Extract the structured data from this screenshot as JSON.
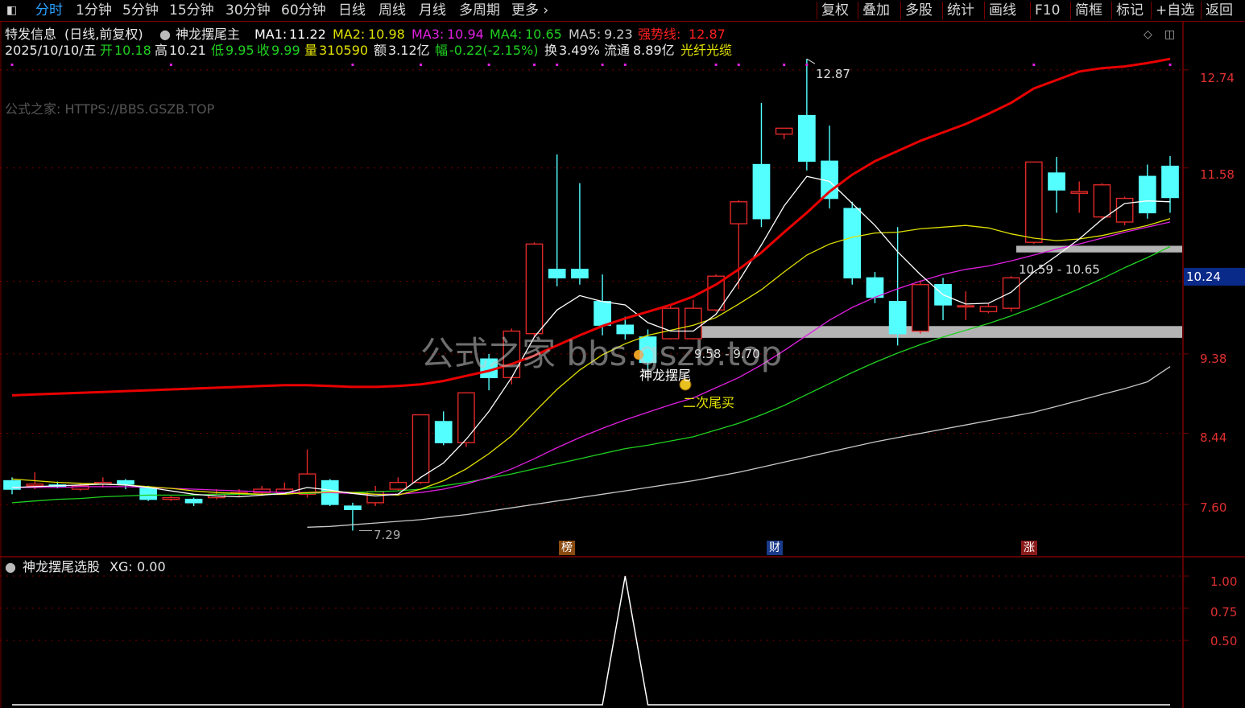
{
  "toolbar": {
    "period_tabs": [
      "分时",
      "1分钟",
      "5分钟",
      "15分钟",
      "30分钟",
      "60分钟",
      "日线",
      "周线",
      "月线",
      "多周期",
      "更多"
    ],
    "active_tab": "分时",
    "right_buttons": [
      "复权",
      "叠加",
      "多股",
      "统计",
      "画线",
      "F10",
      "简框",
      "标记",
      "+自选",
      "返回"
    ]
  },
  "header": {
    "stock_name": "特发信息",
    "mode": "(日线,前复权)",
    "indicator_name": "神龙摆尾主",
    "ma1_label": "MA1:",
    "ma1_value": "11.22",
    "ma2_label": "MA2:",
    "ma2_value": "10.98",
    "ma3_label": "MA3:",
    "ma3_value": "10.94",
    "ma4_label": "MA4:",
    "ma4_value": "10.65",
    "ma5_label": "MA5:",
    "ma5_value": "9.23",
    "strong_label": "强势线:",
    "strong_value": "12.87"
  },
  "quote": {
    "date": "2025/10/10/五",
    "open_label": "开",
    "open": "10.18",
    "high_label": "高",
    "high": "10.21",
    "low_label": "低",
    "low": "9.95",
    "close_label": "收",
    "close": "9.99",
    "vol_label": "量",
    "vol": "310590",
    "amt_label": "额",
    "amt": "3.12亿",
    "chg_label": "幅",
    "chg": "-0.22(-2.15%)",
    "turn_label": "换",
    "turn": "3.49%",
    "float_label": "流通",
    "float": "8.89亿",
    "sector": "光纤光缆"
  },
  "watermark_text": "公式之家: HTTPS://BBS.GSZB.TOP",
  "center_watermark": "公式之家 bbs.gszb.top",
  "annotations": {
    "peak": "12.87",
    "trough": "7.29",
    "zone1": "9.58 - 9.70",
    "zone2": "10.59 - 10.65",
    "signal1": "神龙摆尾",
    "signal2": "二次尾买",
    "mark_bang": "榜",
    "mark_cai": "财",
    "mark_zhang": "涨"
  },
  "price_axis": [
    "12.74",
    "11.58",
    "10.24",
    "9.38",
    "8.44",
    "7.60"
  ],
  "current_price_tag": "10.24",
  "sub_panel": {
    "title": "神龙摆尾选股",
    "xg_label": "XG:",
    "xg_value": "0.00",
    "axis": [
      "1.00",
      "0.75",
      "0.50"
    ]
  },
  "colors": {
    "up": "#e02828",
    "down": "#54ffff",
    "ma1": "#ffffff",
    "ma2": "#e0e000",
    "ma3": "#e020e0",
    "ma4": "#20d020",
    "ma5": "#c8c8c8",
    "strong": "#e80000",
    "grid": "#7a0000",
    "active_tab": "#2aa0ff"
  },
  "chart_data": {
    "type": "candlestick",
    "candles": [
      [
        7.88,
        7.78,
        7.92,
        7.72
      ],
      [
        7.82,
        7.84,
        7.98,
        7.78
      ],
      [
        7.83,
        7.82,
        7.87,
        7.79
      ],
      [
        7.78,
        7.82,
        7.85,
        7.76
      ],
      [
        7.84,
        7.86,
        7.92,
        7.8
      ],
      [
        7.88,
        7.84,
        7.9,
        7.78
      ],
      [
        7.8,
        7.66,
        7.82,
        7.64
      ],
      [
        7.66,
        7.68,
        7.7,
        7.64
      ],
      [
        7.66,
        7.62,
        7.68,
        7.58
      ],
      [
        7.68,
        7.72,
        7.78,
        7.66
      ],
      [
        7.72,
        7.74,
        7.78,
        7.7
      ],
      [
        7.74,
        7.78,
        7.82,
        7.7
      ],
      [
        7.74,
        7.78,
        7.86,
        7.72
      ],
      [
        7.72,
        7.96,
        8.25,
        7.68
      ],
      [
        7.88,
        7.6,
        7.9,
        7.58
      ],
      [
        7.58,
        7.54,
        7.62,
        7.29
      ],
      [
        7.62,
        7.75,
        7.82,
        7.58
      ],
      [
        7.78,
        7.86,
        7.92,
        7.76
      ],
      [
        7.86,
        8.66,
        8.66,
        7.84
      ],
      [
        8.58,
        8.33,
        8.7,
        8.3
      ],
      [
        8.33,
        8.92,
        8.92,
        8.28
      ],
      [
        9.32,
        9.1,
        9.38,
        8.95
      ],
      [
        9.1,
        9.65,
        9.68,
        9.02
      ],
      [
        9.62,
        10.68,
        10.7,
        9.58
      ],
      [
        10.38,
        10.28,
        11.74,
        10.18
      ],
      [
        10.38,
        10.28,
        11.4,
        10.2
      ],
      [
        10.0,
        9.72,
        10.32,
        9.6
      ],
      [
        9.72,
        9.62,
        9.82,
        9.55
      ],
      [
        9.58,
        9.28,
        9.67,
        9.2
      ],
      [
        9.56,
        9.92,
        9.95,
        9.55
      ],
      [
        9.56,
        9.92,
        10.02,
        9.55
      ],
      [
        9.9,
        10.3,
        10.32,
        9.88
      ],
      [
        10.92,
        11.18,
        11.2,
        10.15
      ],
      [
        11.62,
        10.98,
        12.35,
        10.88
      ],
      [
        11.98,
        12.05,
        12.05,
        11.92
      ],
      [
        12.2,
        11.66,
        12.87,
        11.55
      ],
      [
        11.66,
        11.22,
        12.08,
        11.1
      ],
      [
        11.1,
        10.28,
        11.18,
        10.2
      ],
      [
        10.28,
        10.05,
        10.35,
        9.98
      ],
      [
        10.0,
        9.62,
        10.88,
        9.48
      ],
      [
        9.65,
        10.2,
        10.25,
        9.62
      ],
      [
        10.2,
        9.96,
        10.28,
        9.78
      ],
      [
        9.95,
        9.95,
        10.12,
        9.78
      ],
      [
        9.88,
        9.94,
        9.98,
        9.86
      ],
      [
        9.92,
        10.28,
        10.3,
        9.88
      ],
      [
        10.7,
        11.65,
        11.65,
        10.68
      ],
      [
        11.52,
        11.32,
        11.71,
        11.05
      ],
      [
        11.28,
        11.3,
        11.42,
        11.05
      ],
      [
        11.0,
        11.38,
        11.4,
        10.98
      ],
      [
        10.94,
        11.22,
        11.24,
        10.9
      ],
      [
        11.48,
        11.05,
        11.62,
        10.98
      ],
      [
        11.6,
        11.23,
        11.72,
        11.05
      ]
    ],
    "ma1": [
      7.8,
      7.81,
      7.82,
      7.83,
      7.84,
      7.83,
      7.8,
      7.76,
      7.72,
      7.7,
      7.69,
      7.71,
      7.73,
      7.8,
      7.77,
      7.73,
      7.7,
      7.72,
      7.92,
      8.09,
      8.37,
      8.7,
      9.1,
      9.58,
      9.9,
      10.07,
      10.0,
      9.96,
      9.75,
      9.65,
      9.65,
      9.85,
      10.24,
      10.67,
      11.13,
      11.48,
      11.42,
      11.16,
      10.9,
      10.59,
      10.32,
      10.08,
      9.97,
      9.98,
      10.11,
      10.35,
      10.54,
      10.74,
      10.97,
      11.16,
      11.19,
      11.18
    ],
    "ma2": [
      7.9,
      7.88,
      7.86,
      7.85,
      7.84,
      7.83,
      7.81,
      7.79,
      7.76,
      7.74,
      7.73,
      7.72,
      7.72,
      7.74,
      7.75,
      7.74,
      7.72,
      7.71,
      7.78,
      7.88,
      8.02,
      8.2,
      8.41,
      8.69,
      8.96,
      9.19,
      9.37,
      9.5,
      9.6,
      9.66,
      9.72,
      9.81,
      9.97,
      10.14,
      10.35,
      10.55,
      10.68,
      10.76,
      10.81,
      10.82,
      10.86,
      10.88,
      10.9,
      10.87,
      10.8,
      10.75,
      10.72,
      10.74,
      10.78,
      10.84,
      10.9,
      10.98
    ],
    "ma3": [
      7.8,
      7.8,
      7.8,
      7.81,
      7.81,
      7.81,
      7.8,
      7.79,
      7.78,
      7.77,
      7.76,
      7.75,
      7.74,
      7.74,
      7.74,
      7.73,
      7.72,
      7.72,
      7.74,
      7.78,
      7.84,
      7.92,
      8.02,
      8.14,
      8.27,
      8.39,
      8.5,
      8.6,
      8.69,
      8.78,
      8.86,
      8.98,
      9.1,
      9.25,
      9.42,
      9.6,
      9.78,
      9.93,
      10.05,
      10.15,
      10.24,
      10.32,
      10.38,
      10.42,
      10.48,
      10.55,
      10.62,
      10.68,
      10.75,
      10.82,
      10.88,
      10.94
    ],
    "ma4": [
      7.62,
      7.64,
      7.66,
      7.67,
      7.69,
      7.7,
      7.71,
      7.71,
      7.71,
      7.72,
      7.72,
      7.72,
      7.73,
      7.73,
      7.74,
      7.74,
      7.75,
      7.76,
      7.78,
      7.82,
      7.86,
      7.91,
      7.96,
      8.02,
      8.08,
      8.14,
      8.2,
      8.26,
      8.3,
      8.35,
      8.4,
      8.48,
      8.56,
      8.66,
      8.77,
      8.9,
      9.03,
      9.16,
      9.28,
      9.39,
      9.49,
      9.58,
      9.66,
      9.74,
      9.83,
      9.93,
      10.04,
      10.15,
      10.27,
      10.4,
      10.52,
      10.65
    ],
    "ma5": [
      null,
      null,
      null,
      null,
      null,
      null,
      null,
      null,
      null,
      null,
      null,
      null,
      null,
      7.33,
      7.34,
      7.36,
      7.38,
      7.4,
      7.42,
      7.45,
      7.48,
      7.52,
      7.56,
      7.6,
      7.64,
      7.68,
      7.72,
      7.76,
      7.8,
      7.84,
      7.88,
      7.93,
      7.98,
      8.04,
      8.1,
      8.16,
      8.22,
      8.28,
      8.34,
      8.39,
      8.44,
      8.49,
      8.54,
      8.59,
      8.64,
      8.69,
      8.76,
      8.83,
      8.9,
      8.97,
      9.05,
      9.23
    ],
    "strong": [
      8.89,
      8.9,
      8.91,
      8.92,
      8.93,
      8.94,
      8.95,
      8.96,
      8.97,
      8.98,
      8.99,
      9.0,
      9.01,
      9.01,
      9.0,
      8.99,
      8.99,
      9.0,
      9.02,
      9.06,
      9.12,
      9.18,
      9.26,
      9.36,
      9.48,
      9.6,
      9.71,
      9.8,
      9.88,
      9.96,
      10.06,
      10.2,
      10.38,
      10.58,
      10.82,
      11.05,
      11.3,
      11.5,
      11.66,
      11.78,
      11.9,
      12.0,
      12.1,
      12.22,
      12.35,
      12.52,
      12.62,
      12.72,
      12.76,
      12.78,
      12.82,
      12.87
    ],
    "xg": [
      0,
      0,
      0,
      0,
      0,
      0,
      0,
      0,
      0,
      0,
      0,
      0,
      0,
      0,
      0,
      0,
      0,
      0,
      0,
      0,
      0,
      0,
      0,
      0,
      0,
      0,
      0,
      1,
      0,
      0,
      0,
      0,
      0,
      0,
      0,
      0,
      0,
      0,
      0,
      0,
      0,
      0,
      0,
      0,
      0,
      0,
      0,
      0,
      0,
      0,
      0,
      0
    ],
    "price_range": [
      7.0,
      13.3
    ],
    "sub_range": [
      0,
      1.1
    ],
    "zones": [
      [
        9.58,
        9.7
      ],
      [
        10.59,
        10.65
      ]
    ]
  }
}
